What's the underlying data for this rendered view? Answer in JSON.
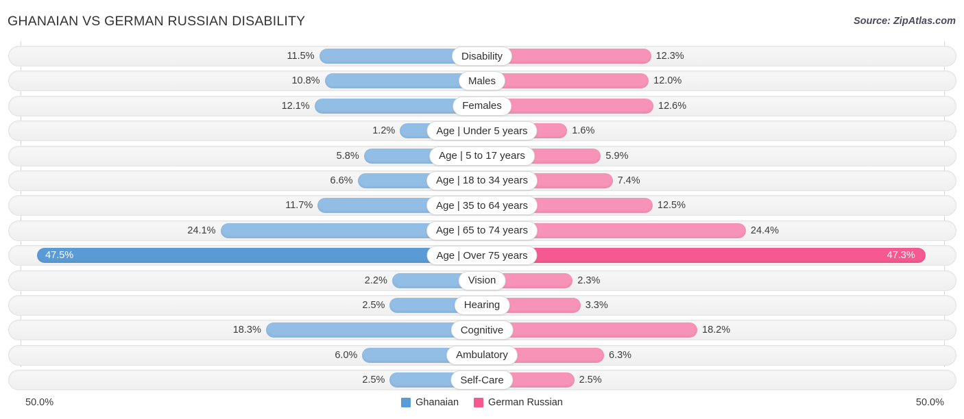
{
  "header": {
    "title": "GHANAIAN VS GERMAN RUSSIAN DISABILITY",
    "source": "Source: ZipAtlas.com"
  },
  "axis": {
    "left_label": "50.0%",
    "right_label": "50.0%",
    "max": 50.0
  },
  "legend": {
    "items": [
      {
        "label": "Ghanaian",
        "color": "#5b9bd5"
      },
      {
        "label": "German Russian",
        "color": "#f4598f"
      }
    ]
  },
  "colors": {
    "left_bar": "#92bde4",
    "right_bar": "#f793b6",
    "left_bar_highlight": "#5b9bd5",
    "right_bar_highlight": "#f4598f",
    "track": "#f4f4f4",
    "gridline": "#d9d9d9"
  },
  "chart_data": {
    "type": "bar",
    "subtype": "diverging-bidirectional",
    "title": "GHANAIAN VS GERMAN RUSSIAN DISABILITY",
    "xlabel": "",
    "ylabel": "",
    "xlim": [
      -50.0,
      50.0
    ],
    "grid": true,
    "legend_position": "bottom-center",
    "axis_tick_labels": [
      "50.0%",
      "50.0%"
    ],
    "categories": [
      "Disability",
      "Males",
      "Females",
      "Age | Under 5 years",
      "Age | 5 to 17 years",
      "Age | 18 to 34 years",
      "Age | 35 to 64 years",
      "Age | 65 to 74 years",
      "Age | Over 75 years",
      "Vision",
      "Hearing",
      "Cognitive",
      "Ambulatory",
      "Self-Care"
    ],
    "series": [
      {
        "name": "Ghanaian",
        "color": "#92bde4",
        "values": [
          11.5,
          10.8,
          12.1,
          1.2,
          5.8,
          6.6,
          11.7,
          24.1,
          47.5,
          2.2,
          2.5,
          18.3,
          6.0,
          2.5
        ],
        "labels": [
          "11.5%",
          "10.8%",
          "12.1%",
          "1.2%",
          "5.8%",
          "6.6%",
          "11.7%",
          "24.1%",
          "47.5%",
          "2.2%",
          "2.5%",
          "18.3%",
          "6.0%",
          "2.5%"
        ]
      },
      {
        "name": "German Russian",
        "color": "#f793b6",
        "values": [
          12.3,
          12.0,
          12.6,
          1.6,
          5.9,
          7.4,
          12.5,
          24.4,
          47.3,
          2.3,
          3.3,
          18.2,
          6.3,
          2.5
        ],
        "labels": [
          "12.3%",
          "12.0%",
          "12.6%",
          "1.6%",
          "5.9%",
          "7.4%",
          "12.5%",
          "24.4%",
          "47.3%",
          "2.3%",
          "3.3%",
          "18.2%",
          "6.3%",
          "2.5%"
        ]
      }
    ],
    "highlighted_rows": [
      8
    ]
  },
  "rows": [
    {
      "label": "Disability",
      "left": "11.5%",
      "right": "12.3%",
      "left_v": 11.5,
      "right_v": 12.3,
      "hl": false
    },
    {
      "label": "Males",
      "left": "10.8%",
      "right": "12.0%",
      "left_v": 10.8,
      "right_v": 12.0,
      "hl": false
    },
    {
      "label": "Females",
      "left": "12.1%",
      "right": "12.6%",
      "left_v": 12.1,
      "right_v": 12.6,
      "hl": false
    },
    {
      "label": "Age | Under 5 years",
      "left": "1.2%",
      "right": "1.6%",
      "left_v": 1.2,
      "right_v": 1.6,
      "hl": false
    },
    {
      "label": "Age | 5 to 17 years",
      "left": "5.8%",
      "right": "5.9%",
      "left_v": 5.8,
      "right_v": 5.9,
      "hl": false
    },
    {
      "label": "Age | 18 to 34 years",
      "left": "6.6%",
      "right": "7.4%",
      "left_v": 6.6,
      "right_v": 7.4,
      "hl": false
    },
    {
      "label": "Age | 35 to 64 years",
      "left": "11.7%",
      "right": "12.5%",
      "left_v": 11.7,
      "right_v": 12.5,
      "hl": false
    },
    {
      "label": "Age | 65 to 74 years",
      "left": "24.1%",
      "right": "24.4%",
      "left_v": 24.1,
      "right_v": 24.4,
      "hl": false
    },
    {
      "label": "Age | Over 75 years",
      "left": "47.5%",
      "right": "47.3%",
      "left_v": 47.5,
      "right_v": 47.3,
      "hl": true
    },
    {
      "label": "Vision",
      "left": "2.2%",
      "right": "2.3%",
      "left_v": 2.2,
      "right_v": 2.3,
      "hl": false
    },
    {
      "label": "Hearing",
      "left": "2.5%",
      "right": "3.3%",
      "left_v": 2.5,
      "right_v": 3.3,
      "hl": false
    },
    {
      "label": "Cognitive",
      "left": "18.3%",
      "right": "18.2%",
      "left_v": 18.3,
      "right_v": 18.2,
      "hl": false
    },
    {
      "label": "Ambulatory",
      "left": "6.0%",
      "right": "6.3%",
      "left_v": 6.0,
      "right_v": 6.3,
      "hl": false
    },
    {
      "label": "Self-Care",
      "left": "2.5%",
      "right": "2.5%",
      "left_v": 2.5,
      "right_v": 2.5,
      "hl": false
    }
  ]
}
